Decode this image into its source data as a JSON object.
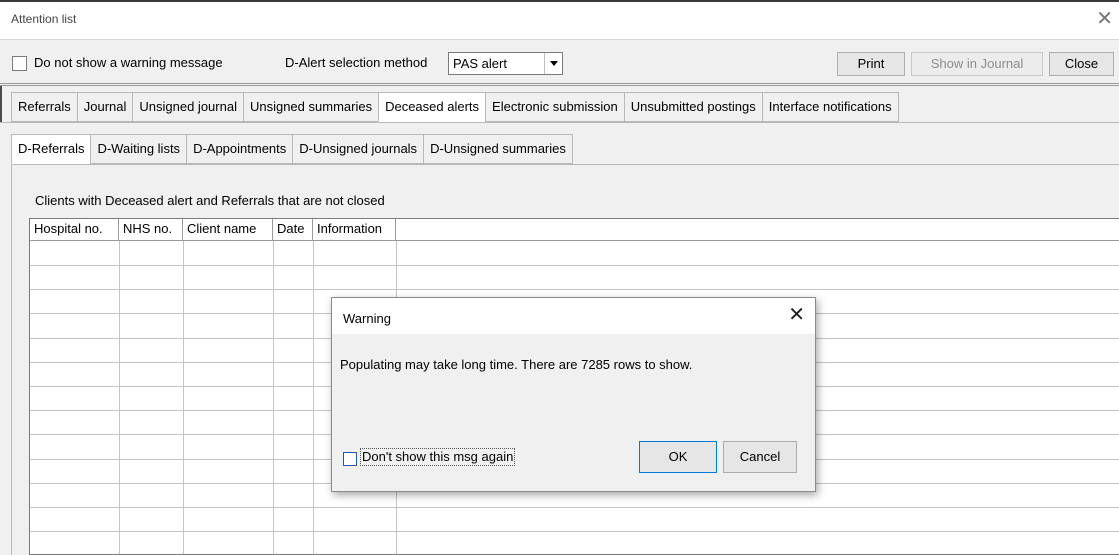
{
  "window": {
    "title": "Attention list",
    "close_symbol": "✕"
  },
  "toolbar": {
    "no_warning_label": "Do not show a warning message",
    "method_label": "D-Alert selection method",
    "method_value": "PAS alert",
    "print_label": "Print",
    "show_in_journal_label": "Show in Journal",
    "close_label": "Close"
  },
  "tabs": [
    {
      "label": "Referrals",
      "active": false
    },
    {
      "label": "Journal",
      "active": false
    },
    {
      "label": "Unsigned journal",
      "active": false
    },
    {
      "label": "Unsigned summaries",
      "active": false
    },
    {
      "label": "Deceased alerts",
      "active": true
    },
    {
      "label": "Electronic submission",
      "active": false
    },
    {
      "label": "Unsubmitted postings",
      "active": false
    },
    {
      "label": "Interface notifications",
      "active": false
    }
  ],
  "subtabs": [
    {
      "label": "D-Referrals",
      "active": true
    },
    {
      "label": "D-Waiting lists",
      "active": false
    },
    {
      "label": "D-Appointments",
      "active": false
    },
    {
      "label": "D-Unsigned journals",
      "active": false
    },
    {
      "label": "D-Unsigned summaries",
      "active": false
    }
  ],
  "grid": {
    "caption": "Clients with Deceased alert and Referrals that are not closed",
    "columns": [
      "Hospital no.",
      "NHS no.",
      "Client name",
      "Date",
      "Information"
    ],
    "rows": []
  },
  "dialog": {
    "title": "Warning",
    "close_symbol": "✕",
    "message": "Populating may take long time. There are 7285 rows to show.",
    "checkbox_label": "Don't show this msg again",
    "ok_label": "OK",
    "cancel_label": "Cancel"
  }
}
